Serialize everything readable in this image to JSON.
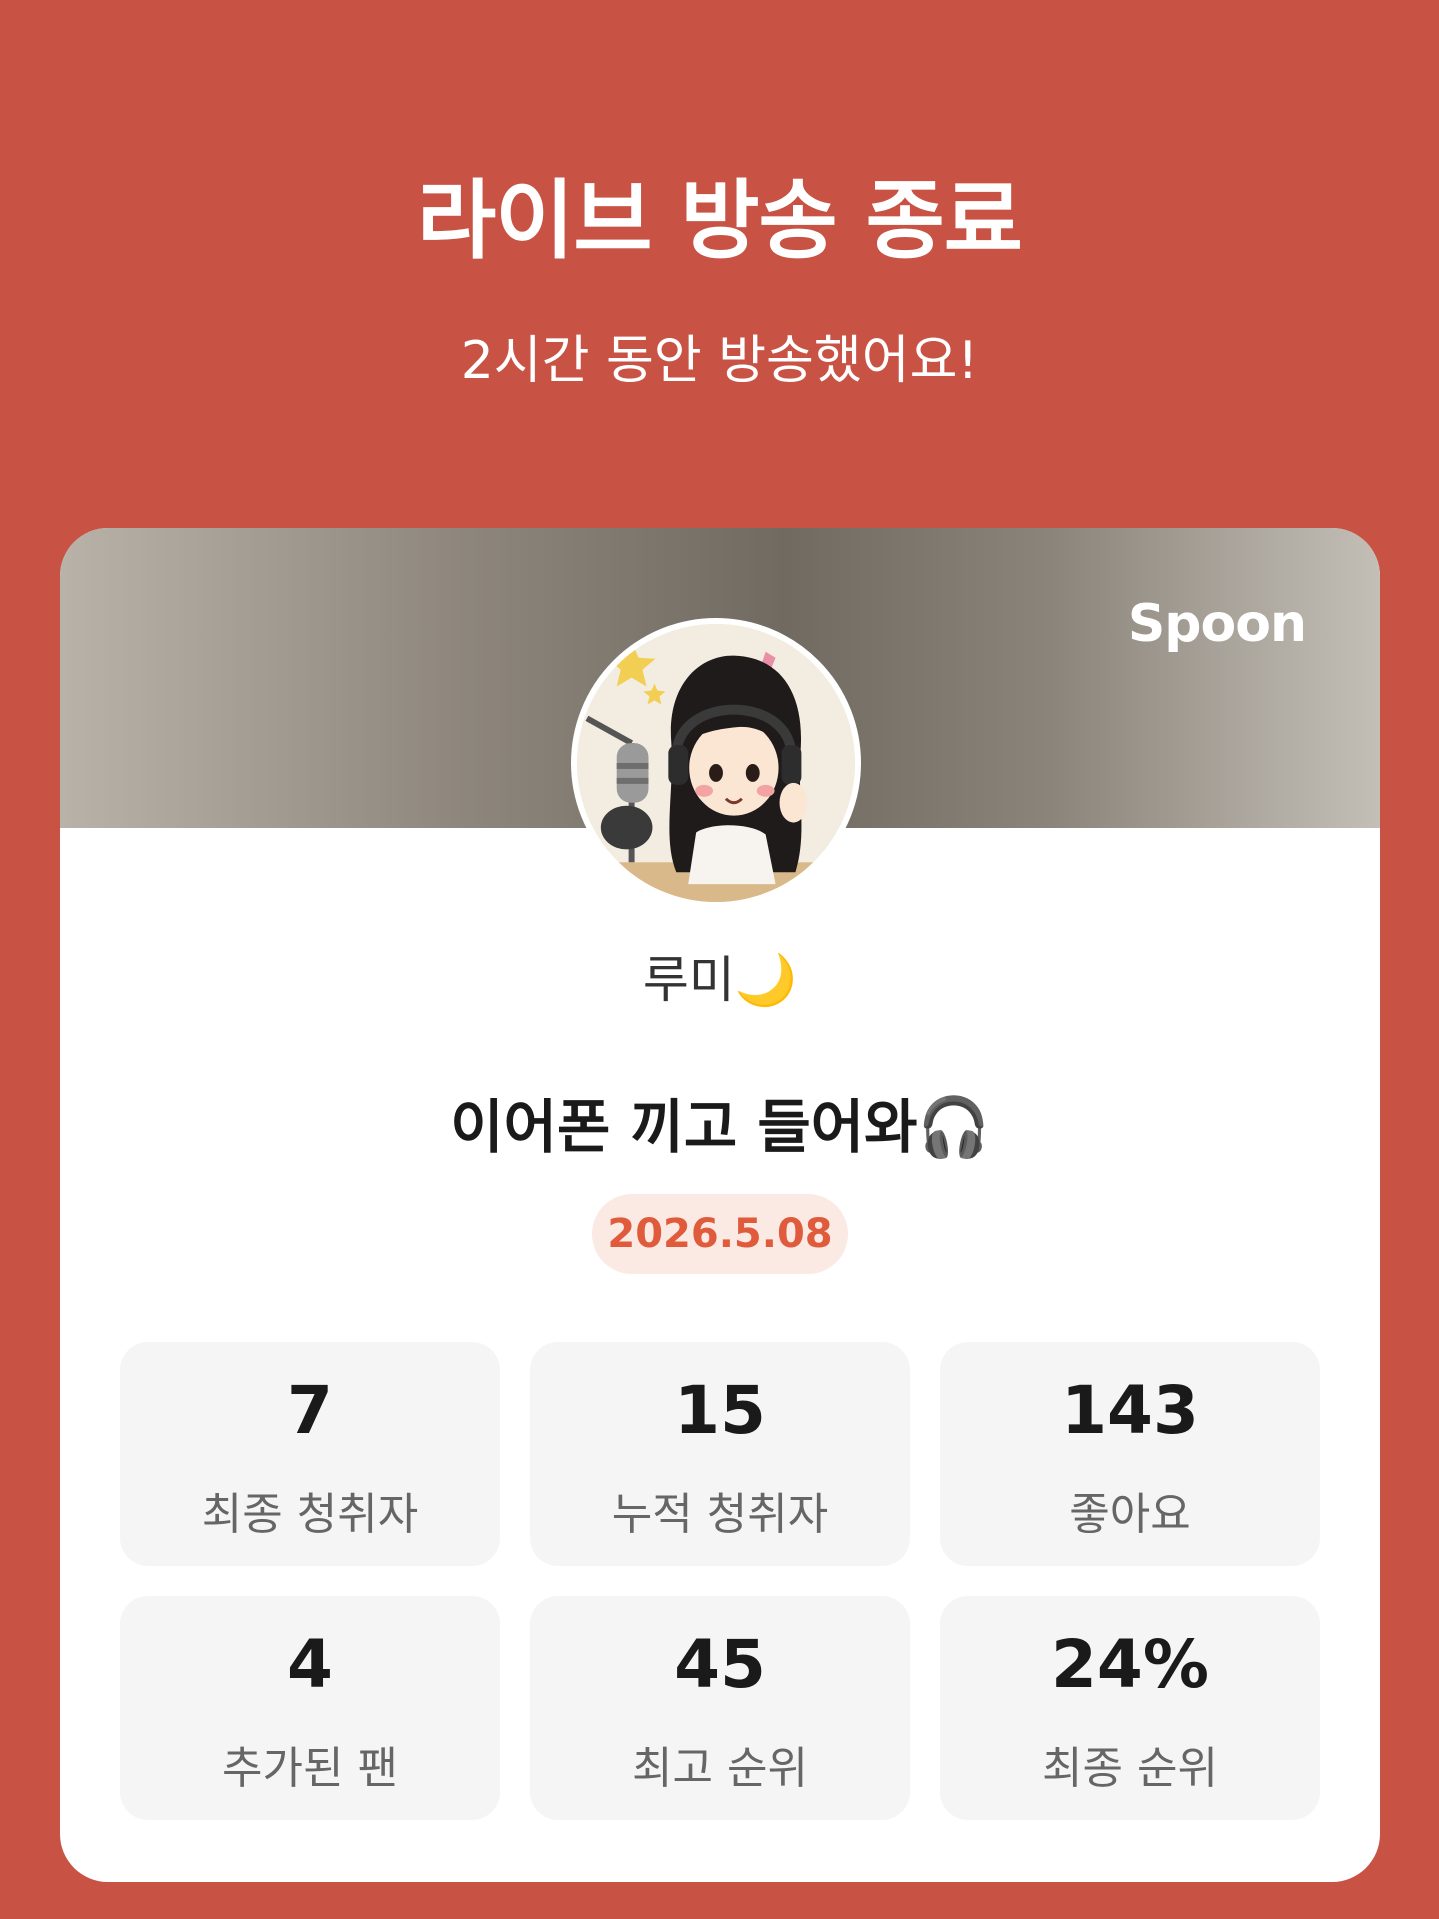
{
  "header": {
    "title": "라이브 방송 종료",
    "subtitle": "2시간 동안 방송했어요!"
  },
  "card": {
    "brand": "Spoon",
    "streamer_name": "루미🌙",
    "stream_title": "이어폰 끼고 들어와🎧",
    "date": "2026.5.08"
  },
  "stats": [
    {
      "value": "7",
      "label": "최종 청취자"
    },
    {
      "value": "15",
      "label": "누적 청취자"
    },
    {
      "value": "143",
      "label": "좋아요"
    },
    {
      "value": "4",
      "label": "추가된 팬"
    },
    {
      "value": "45",
      "label": "최고 순위"
    },
    {
      "value": "24%",
      "label": "최종 순위"
    }
  ],
  "colors": {
    "background": "#c85243",
    "accent": "#e05a3c",
    "badge_bg": "#fbe9e4"
  }
}
